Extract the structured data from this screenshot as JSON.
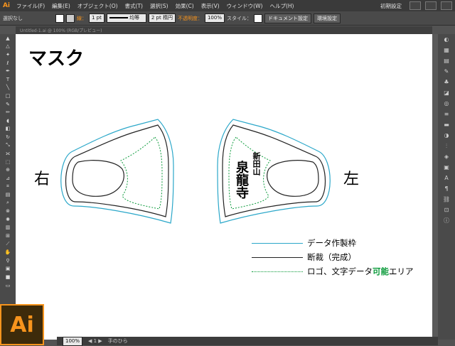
{
  "app": {
    "logo": "Ai"
  },
  "menu": [
    "ファイル(F)",
    "編集(E)",
    "オブジェクト(O)",
    "書式(T)",
    "選択(S)",
    "効果(C)",
    "表示(V)",
    "ウィンドウ(W)",
    "ヘルプ(H)"
  ],
  "workspace": "初期設定",
  "control": {
    "selection": "選択なし",
    "stroke_label": "線：",
    "stroke_value": "1 pt",
    "profile": "均等",
    "brush": "2 pt 楕円",
    "opacity_label": "不透明度：",
    "opacity_value": "100%",
    "style_label": "スタイル：",
    "doc_settings": "ドキュメント設定",
    "env_settings": "環境設定"
  },
  "document_tab": "Untitled-1.ai @ 100% (RGB/プレビュー)",
  "canvas": {
    "title": "マスク",
    "right_label": "右",
    "left_label": "左",
    "logo_text": {
      "line1": "新田山",
      "line2": "泉龍寺"
    },
    "legend": [
      {
        "label": "データ作製枠",
        "color": "#2aa7c9",
        "style": "solid"
      },
      {
        "label": "断裁（完成）",
        "color": "#222222",
        "style": "solid"
      },
      {
        "label_pre": "ロゴ、文字データ",
        "label_em": "可能",
        "label_post": "エリア",
        "color": "#0a9a3a",
        "style": "dotted"
      }
    ]
  },
  "status": {
    "zoom": "100%",
    "tool": "手のひら"
  },
  "ai_logo": "Ai"
}
